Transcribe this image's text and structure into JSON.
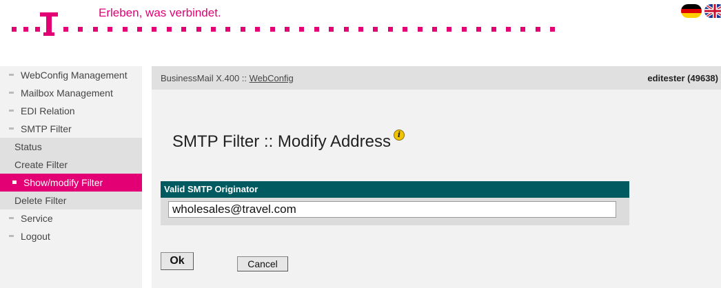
{
  "header": {
    "tagline": "Erleben, was verbindet.",
    "logo_icon": "t-logo-icon",
    "brand_color": "#e20074",
    "flags": [
      "german-flag-icon",
      "uk-flag-icon"
    ]
  },
  "sidebar": {
    "items": [
      {
        "label": "WebConfig Management"
      },
      {
        "label": "Mailbox Management"
      },
      {
        "label": "EDI Relation"
      },
      {
        "label": "SMTP Filter"
      },
      {
        "label": "Status"
      },
      {
        "label": "Create Filter"
      },
      {
        "label": "Show/modify Filter",
        "active": true
      },
      {
        "label": "Delete Filter"
      },
      {
        "label": "Service"
      },
      {
        "label": "Logout"
      }
    ]
  },
  "breadcrumb": {
    "prefix": "BusinessMail X.400 :: ",
    "link": "WebConfig"
  },
  "user": "editester (49638)",
  "page": {
    "title": "SMTP Filter :: Modify Address",
    "info_icon": "info-icon"
  },
  "form": {
    "label": "Valid SMTP Originator",
    "value": "wholesales@travel.com",
    "header_color": "#005a5f"
  },
  "buttons": {
    "ok": "Ok",
    "cancel": "Cancel"
  }
}
